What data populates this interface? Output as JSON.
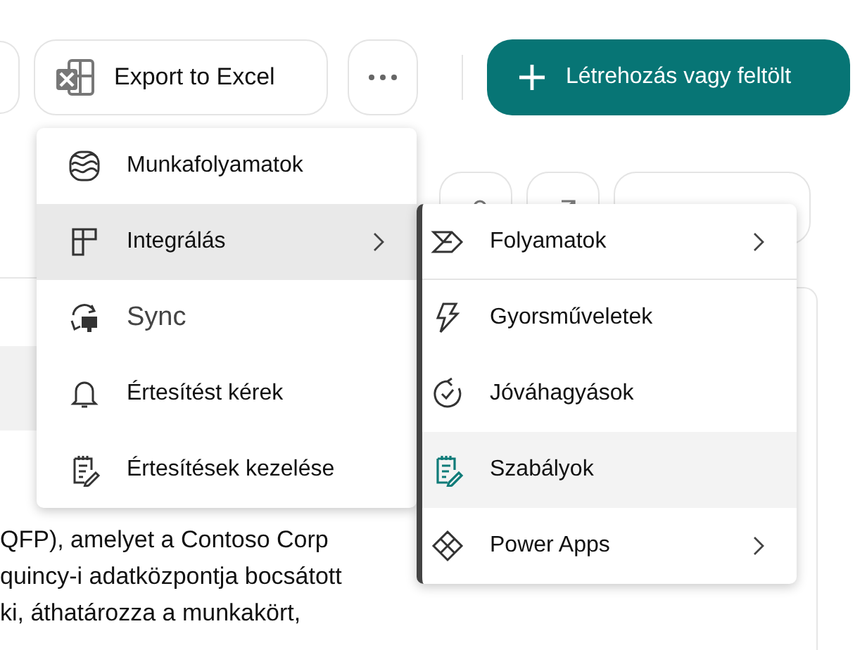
{
  "toolbar": {
    "export_button": {
      "label": "Export to Excel"
    },
    "primary_button": {
      "label": "Létrehozás vagy feltölt"
    }
  },
  "menu": {
    "items": [
      {
        "label": "Munkafolyamatok",
        "selected": false,
        "has_submenu": false
      },
      {
        "label": "Integrálás",
        "selected": true,
        "has_submenu": true
      },
      {
        "label": "Sync",
        "selected": false,
        "has_submenu": false
      },
      {
        "label": "Értesítést kérek",
        "selected": false,
        "has_submenu": false
      },
      {
        "label": "Értesítések kezelése",
        "selected": false,
        "has_submenu": false
      }
    ]
  },
  "submenu": {
    "items": [
      {
        "label": "Folyamatok",
        "selected": false,
        "has_submenu": true
      },
      {
        "label": "Gyorsműveletek",
        "selected": false,
        "has_submenu": false
      },
      {
        "label": "Jóváhagyások",
        "selected": false,
        "has_submenu": false
      },
      {
        "label": "Szabályok",
        "selected": true,
        "has_submenu": false
      },
      {
        "label": "Power Apps",
        "selected": false,
        "has_submenu": true
      }
    ]
  },
  "body_text": [
    "QFP), amelyet a Contoso Corp",
    "quincy-i adatközpontja bocsátott",
    "ki, áthatározza a munkakört,"
  ]
}
